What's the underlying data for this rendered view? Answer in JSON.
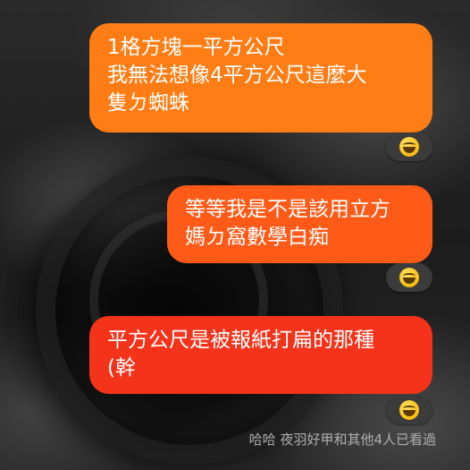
{
  "messages": [
    {
      "lines": [
        "1格方塊一平方公尺",
        "我無法想像4平方公尺這麼大",
        "隻ㄉ蜘蛛"
      ],
      "color": "#ff7d14",
      "reaction": "grinning-squinting-face-icon"
    },
    {
      "lines": [
        "等等我是不是該用立方",
        "媽ㄉ窩數學白痴"
      ],
      "color": "#ff5a17",
      "reaction": "grinning-squinting-face-icon"
    },
    {
      "lines": [
        "平方公尺是被報紙打扁的那種",
        "(幹"
      ],
      "color": "#f5331a",
      "reaction": "grinning-squinting-face-icon"
    }
  ],
  "seen_status": "哈哈 夜羽好甲和其他4人已看過",
  "reaction_bg": "#3b3b3b"
}
